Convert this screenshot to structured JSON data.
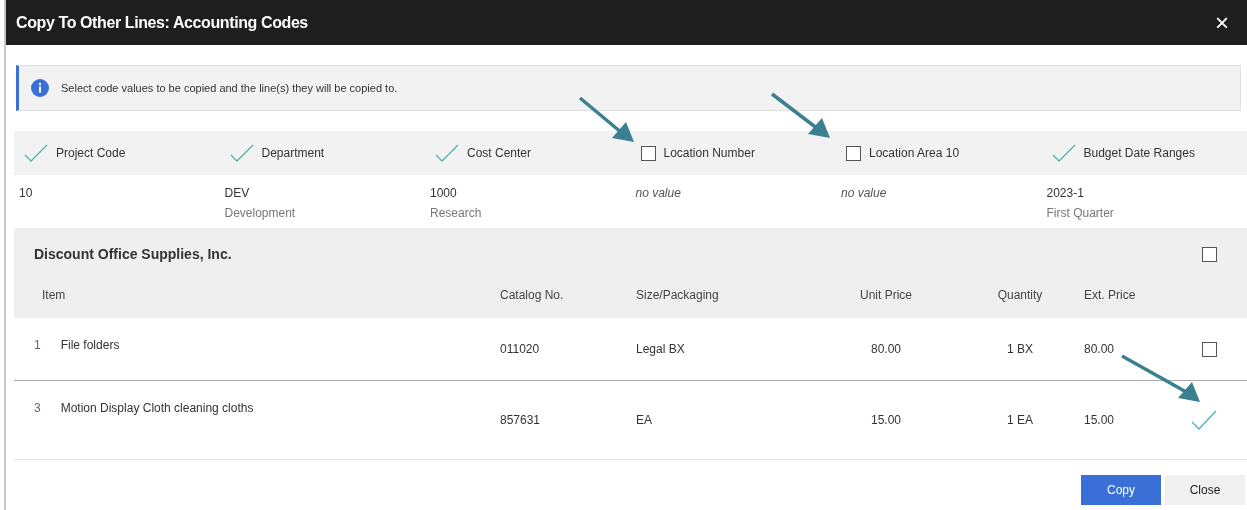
{
  "window": {
    "title": "Copy To Other Lines: Accounting Codes",
    "close": "×"
  },
  "info": "Select code values to be copied and the line(s) they will be copied to.",
  "codes": [
    {
      "label": "Project Code",
      "checked": true,
      "value": "10",
      "empty": false
    },
    {
      "label": "Department",
      "checked": true,
      "value": "DEV",
      "description": "Development",
      "empty": false
    },
    {
      "label": "Cost Center",
      "checked": true,
      "value": "1000",
      "description": "Research",
      "empty": false
    },
    {
      "label": "Location Number",
      "checked": false,
      "value": "no value",
      "empty": true
    },
    {
      "label": "Location Area 10",
      "checked": false,
      "value": "no value",
      "empty": true
    },
    {
      "label": "Budget Date Ranges",
      "checked": true,
      "value": "2023-1",
      "description": "First Quarter",
      "empty": false
    }
  ],
  "vendor": {
    "name": "Discount Office Supplies, Inc.",
    "checked": false
  },
  "table": {
    "columns": [
      "Item",
      "Catalog No.",
      "Size/Packaging",
      "Unit Price",
      "Quantity",
      "Ext. Price"
    ],
    "rows": [
      {
        "line": "1",
        "item": "File folders",
        "catalog": "011020",
        "size": "Legal BX",
        "unit_price": "80.00",
        "quantity": "1 BX",
        "ext_price": "80.00",
        "checked": false
      },
      {
        "line": "3",
        "item": "Motion Display Cloth cleaning cloths",
        "catalog": "857631",
        "size": "EA",
        "unit_price": "15.00",
        "quantity": "1 EA",
        "ext_price": "15.00",
        "checked": true
      }
    ]
  },
  "buttons": [
    {
      "label": "Copy",
      "kind": "primary"
    },
    {
      "label": "Close",
      "kind": "secondary"
    }
  ]
}
